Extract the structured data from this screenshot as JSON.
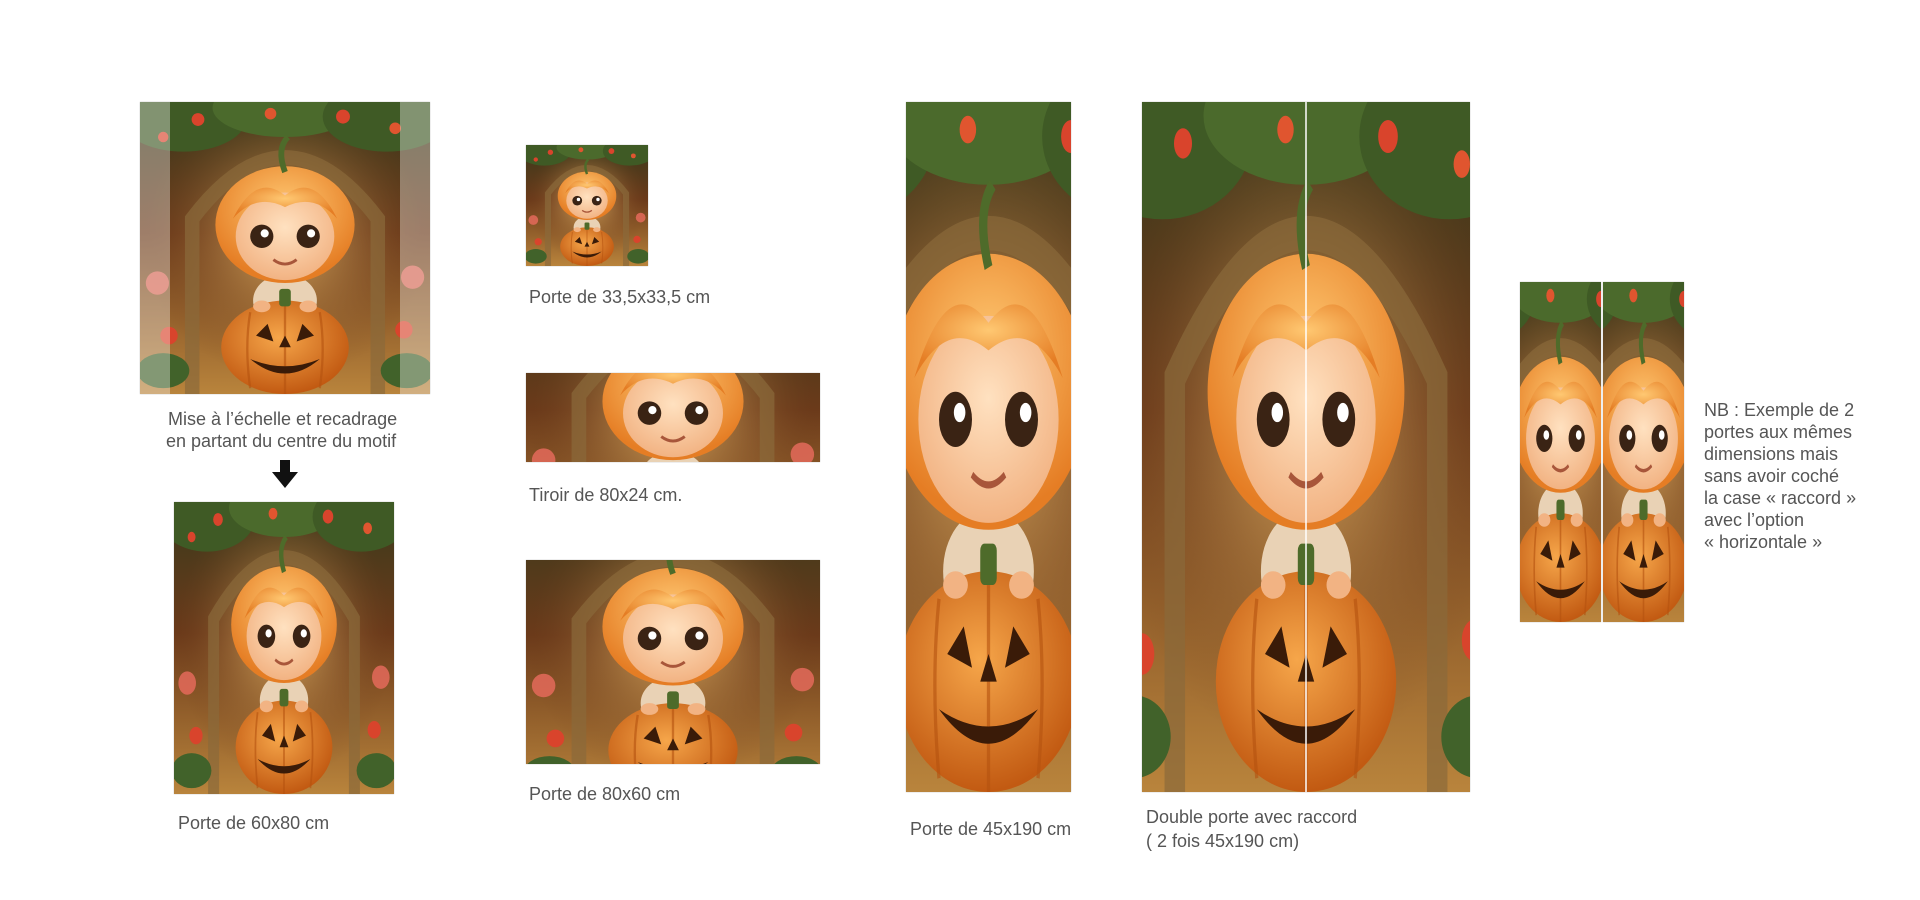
{
  "captions": {
    "scale_line1": "Mise à l’échelle et recadrage",
    "scale_line2": "en partant du centre du motif",
    "door_60x80": "Porte de 60x80 cm",
    "door_33": "Porte de 33,5x33,5 cm",
    "drawer_80x24": "Tiroir de 80x24 cm.",
    "door_80x60": "Porte de 80x60 cm",
    "door_45x190": "Porte de 45x190 cm",
    "double_line1": "Double porte avec raccord",
    "double_line2": "( 2 fois 45x190 cm)"
  },
  "note": {
    "lines": [
      "NB : Exemple de 2",
      "portes aux mêmes",
      "dimensions mais",
      "sans avoir coché",
      "la case « raccord »",
      "avec l’option",
      "« horizontale »"
    ]
  },
  "icons": {
    "arrow": "arrow-down-icon"
  },
  "colors": {
    "text": "#555555",
    "pumpkin": "#e07a1f",
    "foliage": "#3f5a25",
    "flower": "#d9442c"
  }
}
